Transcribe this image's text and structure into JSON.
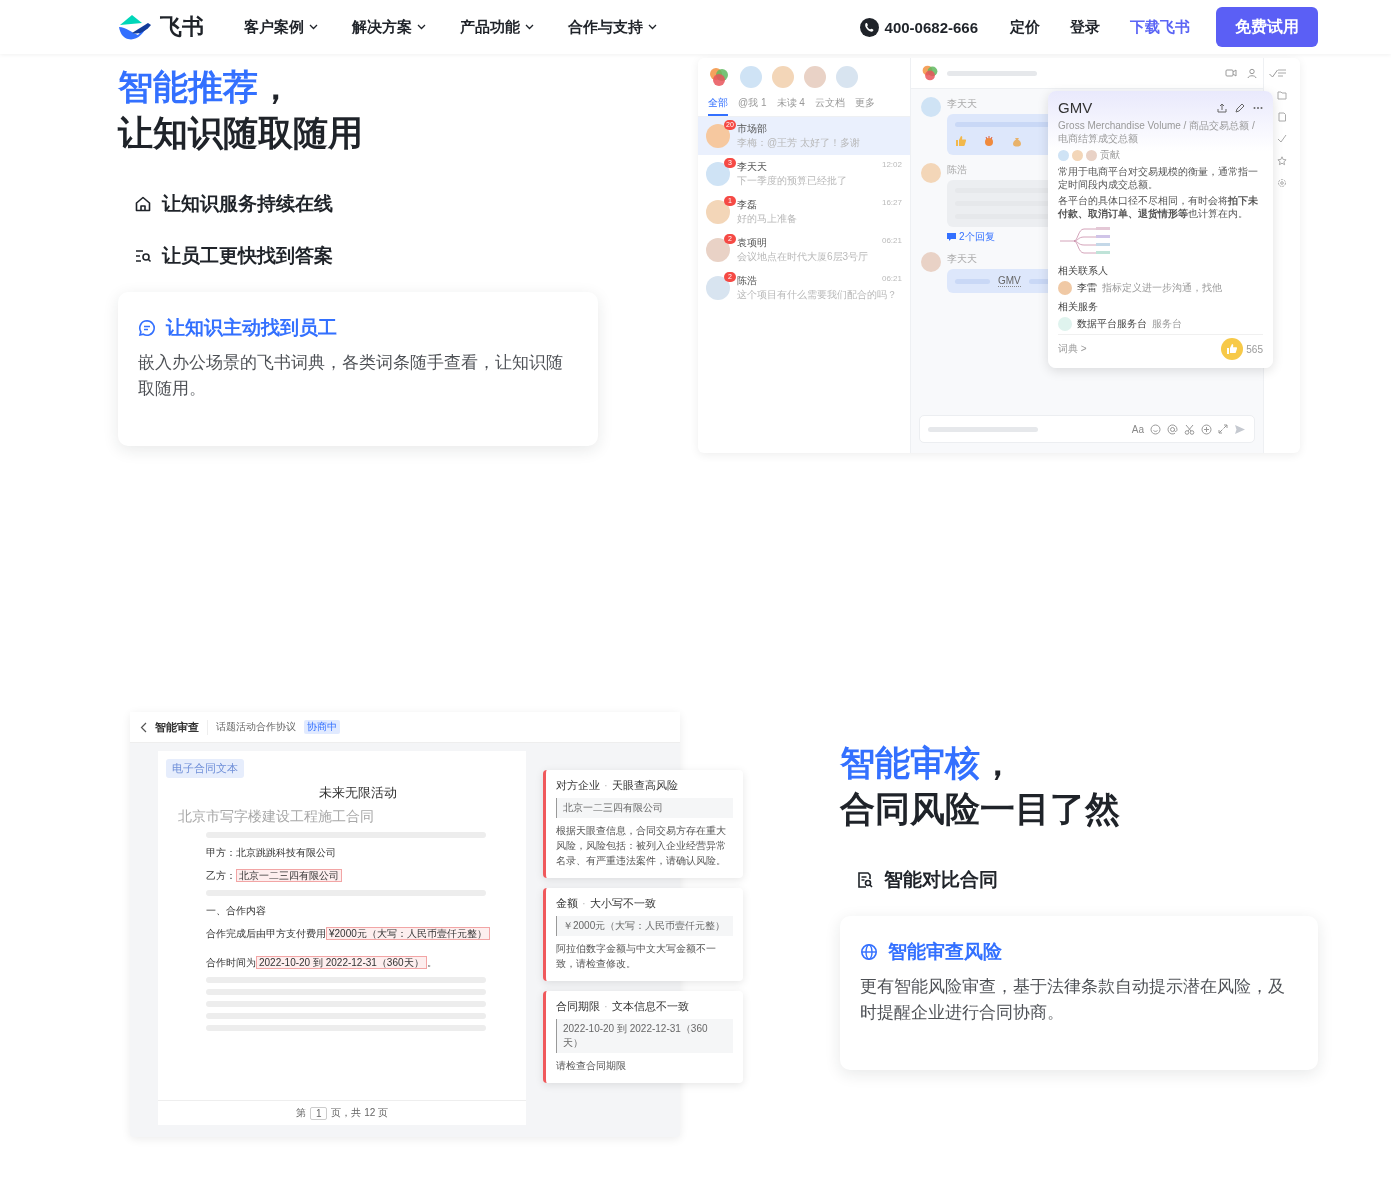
{
  "nav": {
    "logo_text": "飞书",
    "menu": [
      {
        "label": "客户案例"
      },
      {
        "label": "解决方案"
      },
      {
        "label": "产品功能"
      },
      {
        "label": "合作与支持"
      }
    ],
    "phone": "400-0682-666",
    "links": [
      {
        "label": "定价",
        "accent": false
      },
      {
        "label": "登录",
        "accent": false
      },
      {
        "label": "下载飞书",
        "accent": true
      }
    ],
    "cta": "免费试用"
  },
  "recommend_section": {
    "heading": {
      "accent": "智能推荐",
      "after": "，",
      "second_line": "让知识随取随用"
    },
    "features": [
      {
        "label": "让知识服务持续在线",
        "selected": false
      },
      {
        "label": "让员工更快找到答案",
        "selected": false
      },
      {
        "label": "让知识主动找到员工",
        "selected": true,
        "description": "嵌入办公场景的飞书词典，各类词条随手查看，让知识随取随用。"
      }
    ],
    "chat_app": {
      "tabs": [
        {
          "label": "全部",
          "selected": true
        },
        {
          "label": "@我 1",
          "selected": false
        },
        {
          "label": "未读 4",
          "selected": false
        },
        {
          "label": "云文档",
          "selected": false
        },
        {
          "label": "更多",
          "selected": false
        }
      ],
      "conversations": [
        {
          "name": "市场部",
          "preview": "李梅：@王芳 太好了！多谢",
          "badge": "20",
          "selected": true
        },
        {
          "name": "李天天",
          "preview": "下一季度的预算已经批了",
          "time": "12:02",
          "badge": "3",
          "selected": false
        },
        {
          "name": "李磊",
          "preview": "好的马上准备",
          "time": "16:27",
          "badge": "1",
          "selected": false
        },
        {
          "name": "袁项明",
          "preview": "会议地点在时代大厦6层3号厅",
          "time": "06:21",
          "badge": "2",
          "selected": false
        },
        {
          "name": "陈浩",
          "preview": "这个项目有什么需要我们配合的吗？",
          "time": "06:21",
          "badge": "2",
          "selected": false
        }
      ],
      "messages": [
        {
          "sender": "李天天",
          "kind": "reactions"
        },
        {
          "sender": "陈浩",
          "kind": "lines",
          "replies": "2个回复"
        },
        {
          "sender": "李天天",
          "kind": "term",
          "text": "GMV"
        }
      ],
      "input_format_label": "Aa",
      "term_card": {
        "term": "GMV",
        "subtitle": "Gross Merchandise Volume / 商品交易总额 / 电商结算成交总额",
        "contributors_label": "贡献",
        "definition": [
          "常用于电商平台对交易规模的衡量，通常指一定时间段内成交总额。",
          "各平台的具体口径不尽相同，有时会将**拍下未付款、取消订单、退货情形等**也计算在内。"
        ],
        "contacts_title": "相关联系人",
        "contact": {
          "name": "李雷",
          "note": "指标定义进一步沟通，找他"
        },
        "services_title": "相关服务",
        "service": {
          "name": "数据平台服务台",
          "tag": "服务台"
        },
        "footer_link": "词典 >",
        "like_count": "565"
      }
    }
  },
  "review_section": {
    "heading": {
      "accent": "智能审核",
      "after": "，",
      "second_line": "合同风险一目了然"
    },
    "features": [
      {
        "label": "智能对比合同",
        "selected": false
      },
      {
        "label": "智能审查风险",
        "selected": true,
        "description": "更有智能风险审查，基于法律条款自动提示潜在风险，及时提醒企业进行合同协商。"
      }
    ],
    "contract_app": {
      "title": "智能审查",
      "doc_name": "话题活动合作协议",
      "status": "协商中",
      "source_tag": "电子合同文本",
      "faded_title": "北京市写字楼建设工程施工合同",
      "doc_title": "未来无限活动",
      "party_a": "甲方：北京跳跳科技有限公司",
      "party_b_label": "乙方：",
      "party_b": "北京一二三四有限公司",
      "section": "一、合作内容",
      "fee_prefix": "合作完成后由甲方支付费用",
      "fee": "¥2000元（大写：人民币壹仟元整）",
      "period_prefix": "合作时间为",
      "period": "2022-10-20 到 2022-12-31（360天）",
      "period_suffix": "。",
      "pager": {
        "prefix": "第",
        "page": "1",
        "suffix": "页，共 12 页"
      },
      "risk_cards": [
        {
          "category": "对方企业",
          "separator": "·",
          "issue": "天眼查高风险",
          "quote": "北京一二三四有限公司",
          "detail": "根据天眼查信息，合同交易方存在重大风险，风险包括：被列入企业经营异常名录、有严重违法案件，请确认风险。"
        },
        {
          "category": "金额",
          "separator": "·",
          "issue": "大小写不一致",
          "quote": "￥2000元（大写：人民币壹仟元整）",
          "detail": "阿拉伯数字金额与中文大写金额不一致，请检查修改。"
        },
        {
          "category": "合同期限",
          "separator": "·",
          "issue": "文本信息不一致",
          "quote": "2022-10-20 到 2022-12-31（360 天）",
          "detail": "请检查合同期限"
        }
      ]
    }
  }
}
